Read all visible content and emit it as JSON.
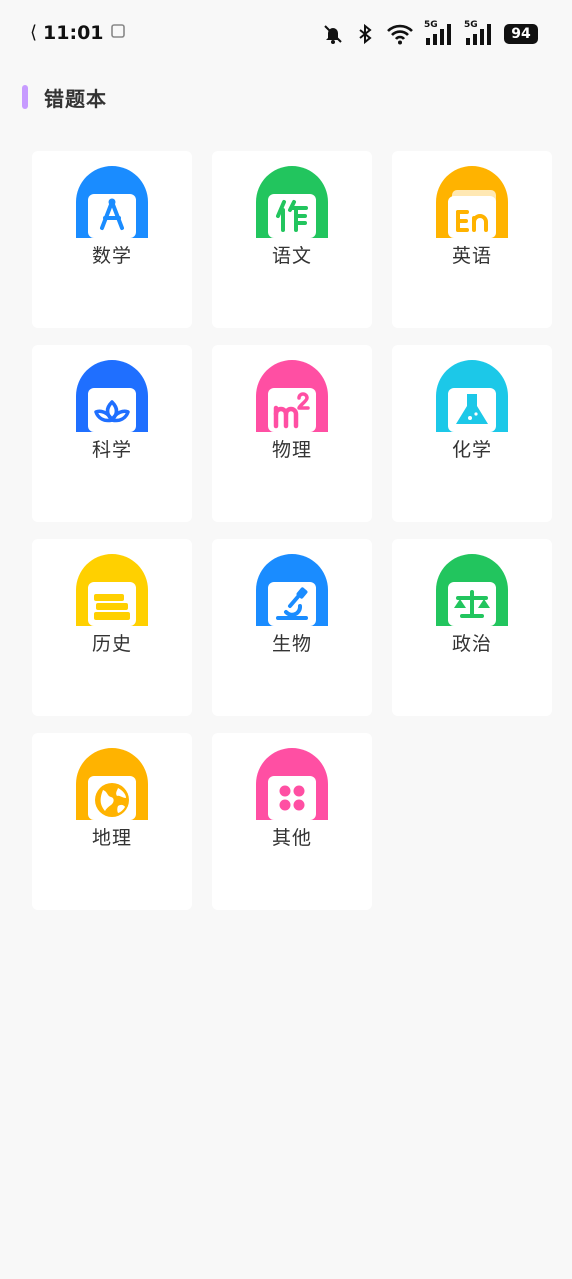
{
  "status_bar": {
    "time": "11:01",
    "signal_1_label": "5G",
    "signal_2_label": "5G",
    "battery": "94",
    "icons": [
      "back-arrow-icon",
      "screen-icon",
      "mute-bell-icon",
      "bluetooth-icon",
      "wifi-icon",
      "signal-icon",
      "signal-icon"
    ]
  },
  "header": {
    "title": "错题本",
    "accent_color": "#c79bff"
  },
  "subjects": [
    {
      "label": "数学",
      "color": "#1a8cff",
      "icon": "compass-icon"
    },
    {
      "label": "语文",
      "color": "#22c55e",
      "icon": "pen-icon"
    },
    {
      "label": "英语",
      "color": "#ffb300",
      "icon": "english-book-icon"
    },
    {
      "label": "科学",
      "color": "#1f6fff",
      "icon": "sprout-icon"
    },
    {
      "label": "物理",
      "color": "#ff4fa3",
      "icon": "square-meter-icon"
    },
    {
      "label": "化学",
      "color": "#1cc8e8",
      "icon": "flask-icon"
    },
    {
      "label": "历史",
      "color": "#ffd000",
      "icon": "books-icon"
    },
    {
      "label": "生物",
      "color": "#1a8cff",
      "icon": "microscope-icon"
    },
    {
      "label": "政治",
      "color": "#22c55e",
      "icon": "scale-icon"
    },
    {
      "label": "地理",
      "color": "#ffb300",
      "icon": "globe-icon"
    },
    {
      "label": "其他",
      "color": "#ff4fa3",
      "icon": "grid-dots-icon"
    }
  ]
}
